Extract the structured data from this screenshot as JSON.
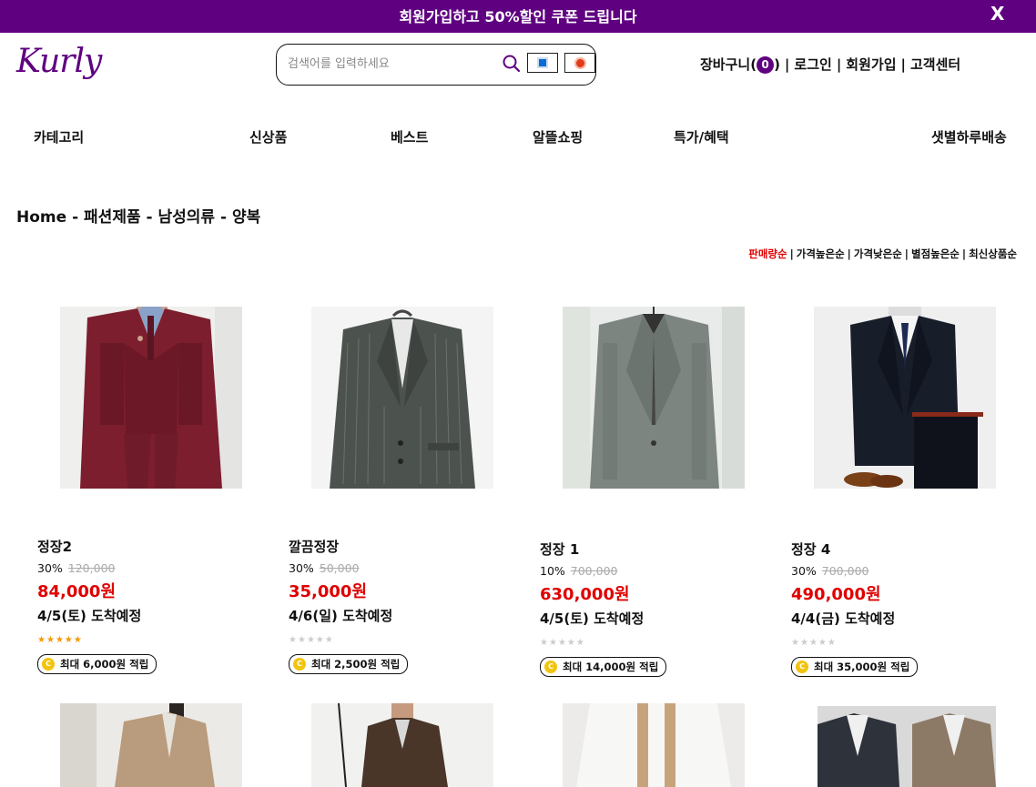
{
  "promo": {
    "text": "회원가입하고 50%할인 쿠폰 드립니다",
    "close": "X"
  },
  "header": {
    "logo": "Kurly",
    "search_placeholder": "검색어를 입력하세요",
    "cart_label": "장바구니(",
    "cart_count": "0",
    "cart_close": ")",
    "login": "로그인",
    "signup": "회원가입",
    "support": "고객센터",
    "separator": "|"
  },
  "nav": [
    "카테고리",
    "신상품",
    "베스트",
    "알뜰쇼핑",
    "특가/혜택",
    "샛별하루배송"
  ],
  "breadcrumb": "Home - 패션제품 - 남성의류 - 양복",
  "sort": {
    "items": [
      "판매량순",
      "가격높은순",
      "가격낮은순",
      "별점높은순",
      "최신상품순"
    ],
    "active": 0
  },
  "products": [
    {
      "name": "정장2",
      "discount": "30%",
      "original": "120,000",
      "price": "84,000원",
      "eta": "4/5(토) 도착예정",
      "rating": 5,
      "points": "최대 6,000원 적립"
    },
    {
      "name": "깔끔정장",
      "discount": "30%",
      "original": "50,000",
      "price": "35,000원",
      "eta": "4/6(일) 도착예정",
      "rating": 0,
      "points": "최대 2,500원 적립"
    },
    {
      "name": "정장 1",
      "discount": "10%",
      "original": "700,000",
      "price": "630,000원",
      "eta": "4/5(토) 도착예정",
      "rating": 0,
      "points": "최대 14,000원 적립"
    },
    {
      "name": "정장 4",
      "discount": "30%",
      "original": "700,000",
      "price": "490,000원",
      "eta": "4/4(금) 도착예정",
      "rating": 0,
      "points": "최대 35,000원 적립"
    }
  ],
  "colors": {
    "brand": "#5f0080",
    "price": "#e00000",
    "star": "#f59a00",
    "coin": "#f2c40f"
  },
  "icons": {
    "search": "search-icon",
    "camera": "camera-icon",
    "record": "record-icon",
    "close": "close-icon",
    "coin": "coin-icon"
  }
}
